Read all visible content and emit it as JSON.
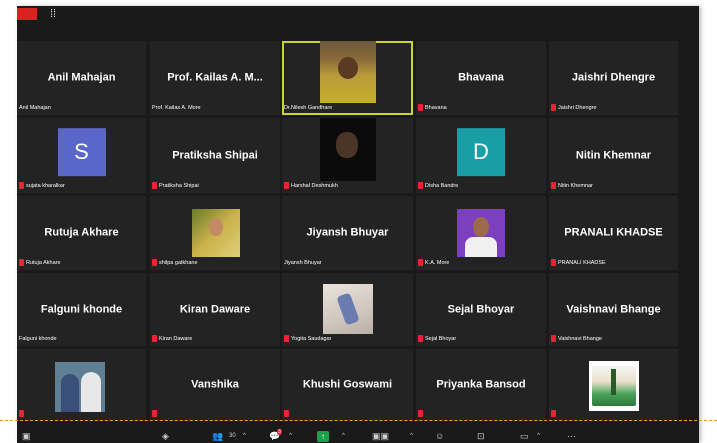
{
  "window": {
    "topbar": {
      "view_icon": "⁞⁞"
    }
  },
  "tiles": [
    {
      "name": "Anil Mahajan",
      "label": "Anil Mahajan",
      "muted": false
    },
    {
      "name": "Prof. Kailas A. M...",
      "label": "Prof. Kailas A. More",
      "muted": false
    },
    {
      "name": "",
      "label": "Dr.Nilesh Gandhare",
      "muted": false,
      "video": "person-video",
      "active": true
    },
    {
      "name": "Bhavana",
      "label": "Bhavana",
      "muted": true
    },
    {
      "name": "Jaishri Dhengre",
      "label": "Jaishri Dhengre",
      "muted": true
    },
    {
      "name": "",
      "label": "sujata kharalkar",
      "muted": true,
      "avatar_letter": "S",
      "avatar_color": "#5a66c9"
    },
    {
      "name": "Pratiksha Shipai",
      "label": "Pratiksha Shipai",
      "muted": true
    },
    {
      "name": "",
      "label": "Harshal Deshmukh",
      "muted": true,
      "video": "dark-video"
    },
    {
      "name": "",
      "label": "Disha Bandre",
      "muted": true,
      "avatar_letter": "D",
      "avatar_color": "#1a9ea6"
    },
    {
      "name": "Nitin Khemnar",
      "label": "Nitin Khemnar",
      "muted": true
    },
    {
      "name": "Rutuja Akhare",
      "label": "Rutuja Akhare",
      "muted": true
    },
    {
      "name": "",
      "label": "shilpa gatkhane",
      "muted": true,
      "video": "photo-yellow"
    },
    {
      "name": "Jiyansh Bhuyar",
      "label": "Jiyansh Bhuyar",
      "muted": false
    },
    {
      "name": "",
      "label": "K.A. More",
      "muted": true,
      "video": "photo-purple"
    },
    {
      "name": "PRANALI KHADSE",
      "label": "PRANALI KHADSE",
      "muted": true
    },
    {
      "name": "Falguni khonde",
      "label": "Falguni khonde",
      "muted": false
    },
    {
      "name": "Kiran Daware",
      "label": "Kiran Daware",
      "muted": true
    },
    {
      "name": "",
      "label": "Yogita Saudagar",
      "muted": true,
      "video": "photo-light"
    },
    {
      "name": "Sejal Bhoyar",
      "label": "Sejal Bhoyar",
      "muted": true
    },
    {
      "name": "Vaishnavi Bhange",
      "label": "Vaishnavi Bhange",
      "muted": true
    },
    {
      "name": "",
      "label": "",
      "muted": true,
      "video": "photo-couple"
    },
    {
      "name": "Vanshika",
      "label": "",
      "muted": true
    },
    {
      "name": "Khushi Goswami",
      "label": "",
      "muted": true
    },
    {
      "name": "Priyanka Bansod",
      "label": "",
      "muted": true
    },
    {
      "name": "",
      "label": "",
      "muted": true,
      "video": "logo-emblem"
    }
  ],
  "toolbar": {
    "participants_count": "30",
    "chat_badge": "3"
  },
  "colors": {
    "active_outline": "#c7d62a",
    "tile_bg": "#232323",
    "mute_red": "#ee2233",
    "share_green": "#1aa14a"
  }
}
